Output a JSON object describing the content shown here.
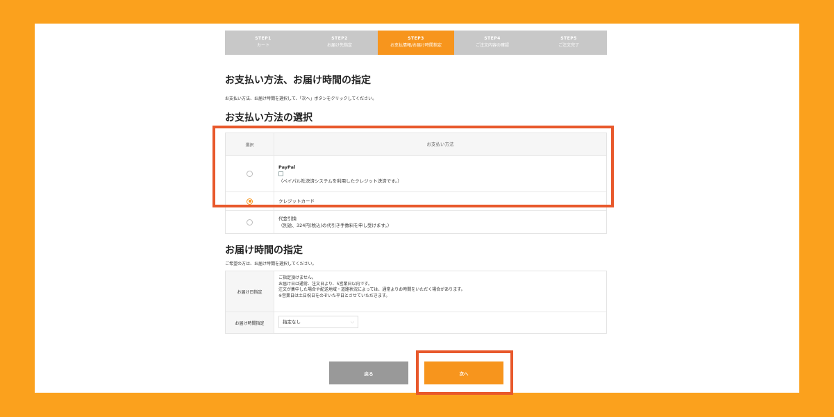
{
  "steps": [
    {
      "num": "STEP1",
      "label": "カート"
    },
    {
      "num": "STEP2",
      "label": "お届け先指定"
    },
    {
      "num": "STEP3",
      "label": "お支払情報/お届け時間指定"
    },
    {
      "num": "STEP4",
      "label": "ご注文内容の確認"
    },
    {
      "num": "STEP5",
      "label": "ご注文完了"
    }
  ],
  "page_title": "お支払い方法、お届け時間の指定",
  "instruction": "お支払い方法、お届け時間を選択して、「次へ」ボタンをクリックしてください。",
  "payment": {
    "heading": "お支払い方法の選択",
    "col_select": "選択",
    "col_method": "お支払い方法",
    "paypal_name": "PayPal",
    "paypal_desc": "（ペイパル社決済システムを利用したクレジット決済です。）",
    "card_name": "クレジットカード",
    "cod_name": "代金引換",
    "cod_desc": "（別途、324円(税込)の代引き手数料を申し受けます。）"
  },
  "delivery": {
    "heading": "お届け時間の指定",
    "note": "ご希望の方は、お届け時間を選択してください。",
    "date_label": "お届け日指定",
    "date_lines": [
      "ご指定頂けません。",
      "お届け日は通常、注文日より、5営業日以内です。",
      "注文が集中した場合や配送地域・道路状況によっては、通常よりお時間をいただく場合があります。",
      "※営業日は土日祝日をのぞいた平日とさせていただきます。"
    ],
    "time_label": "お届け時間指定",
    "time_value": "指定なし"
  },
  "buttons": {
    "back": "戻る",
    "next": "次へ"
  },
  "colors": {
    "accent": "#f7951d",
    "background": "#fba11d",
    "highlight": "#e8582b"
  }
}
